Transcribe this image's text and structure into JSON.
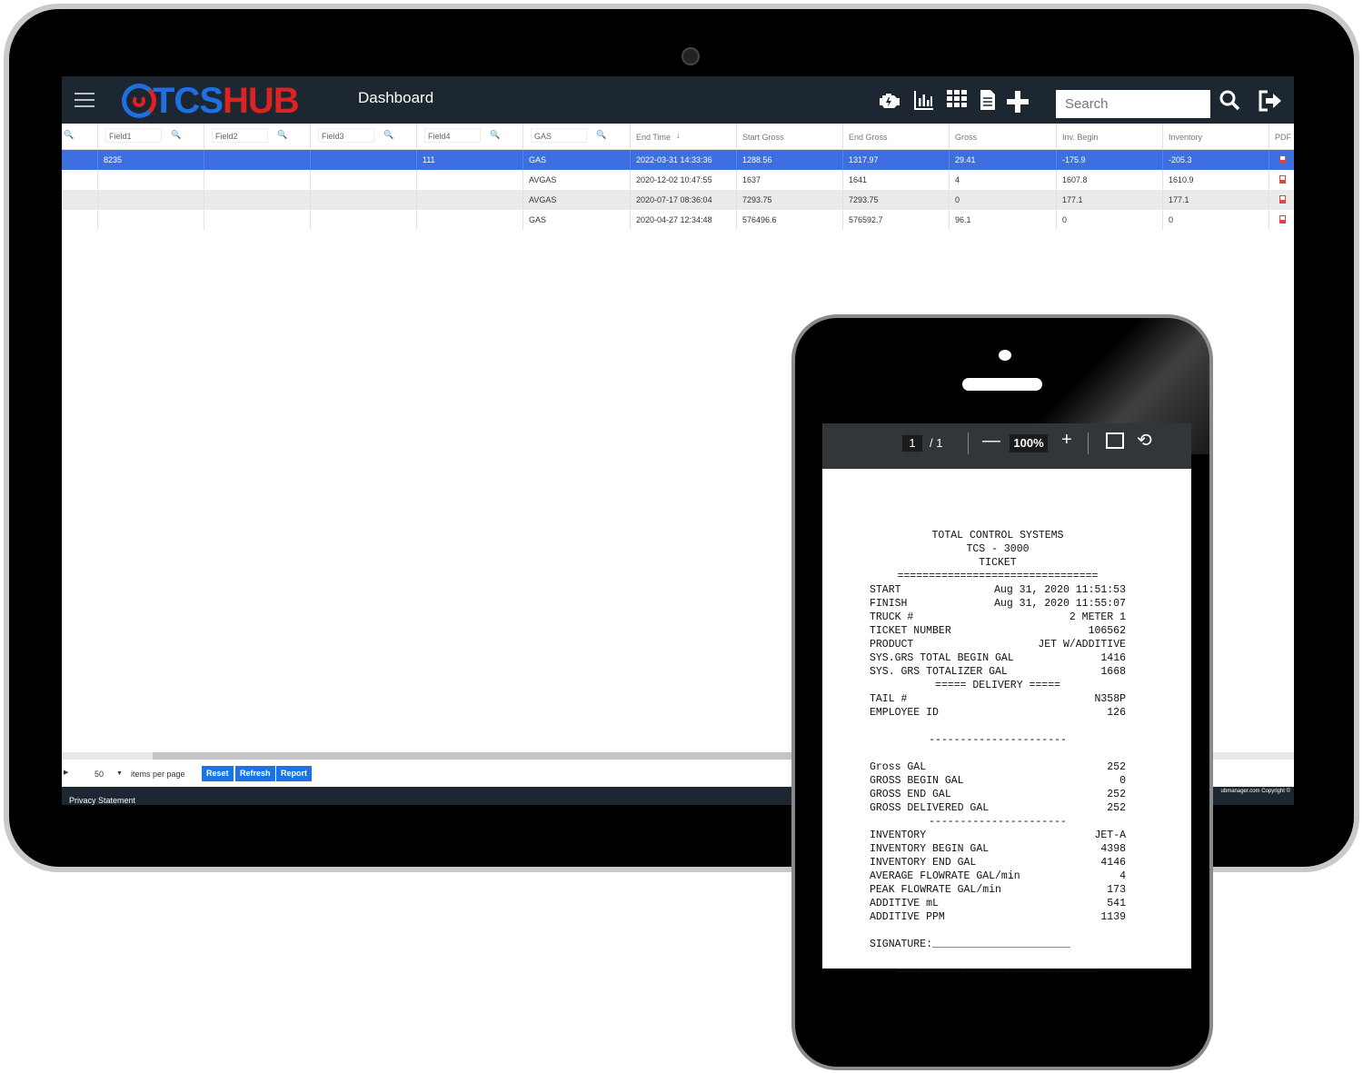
{
  "app": {
    "logo_tcs": "TCS",
    "logo_hub": "HUB",
    "page_title": "Dashboard",
    "search_placeholder": "Search",
    "toolbar_icons": [
      "engine-icon",
      "bar-chart-icon",
      "grid-icon",
      "document-icon",
      "plus-icon",
      "search-icon",
      "logout-icon"
    ]
  },
  "grid": {
    "columns": [
      {
        "key": "c0",
        "label": "",
        "filter": ""
      },
      {
        "key": "field1",
        "label": "",
        "filter": "Field1"
      },
      {
        "key": "field2",
        "label": "",
        "filter": "Field2"
      },
      {
        "key": "field3",
        "label": "",
        "filter": "Field3"
      },
      {
        "key": "field4",
        "label": "",
        "filter": "Field4"
      },
      {
        "key": "product",
        "label": "",
        "filter": "GAS"
      },
      {
        "key": "end_time",
        "label": "End Time"
      },
      {
        "key": "start_gross",
        "label": "Start Gross"
      },
      {
        "key": "end_gross",
        "label": "End Gross"
      },
      {
        "key": "gross",
        "label": "Gross"
      },
      {
        "key": "inv_begin",
        "label": "Inv. Begin"
      },
      {
        "key": "inventory",
        "label": "Inventory"
      },
      {
        "key": "pdf",
        "label": "PDF"
      }
    ],
    "rows": [
      {
        "field1": "8235",
        "field2": "",
        "field3": "",
        "field4": "111",
        "product": "GAS",
        "end_time": "2022-03-31 14:33:36",
        "start_gross": "1288.56",
        "end_gross": "1317.97",
        "gross": "29.41",
        "inv_begin": "-175.9",
        "inventory": "-205.3"
      },
      {
        "field1": "",
        "field2": "",
        "field3": "",
        "field4": "",
        "product": "AVGAS",
        "end_time": "2020-12-02 10:47:55",
        "start_gross": "1637",
        "end_gross": "1641",
        "gross": "4",
        "inv_begin": "1607.8",
        "inventory": "1610.9"
      },
      {
        "field1": "",
        "field2": "",
        "field3": "",
        "field4": "",
        "product": "AVGAS",
        "end_time": "2020-07-17 08:36:04",
        "start_gross": "7293.75",
        "end_gross": "7293.75",
        "gross": "0",
        "inv_begin": "177.1",
        "inventory": "177.1"
      },
      {
        "field1": "",
        "field2": "",
        "field3": "",
        "field4": "",
        "product": "GAS",
        "end_time": "2020-04-27 12:34:48",
        "start_gross": "576496.6",
        "end_gross": "576592.7",
        "gross": "96.1",
        "inv_begin": "0",
        "inventory": "0"
      }
    ]
  },
  "pager": {
    "page_size": "50",
    "items_per_page": "items per page",
    "reset": "Reset",
    "refresh": "Refresh",
    "report": "Report"
  },
  "footer": {
    "privacy": "Privacy Statement",
    "copyright": "ubmanager.com Copyright ©"
  },
  "pdf_viewer": {
    "page_current": "1",
    "page_total": "/ 1",
    "zoom": "100%"
  },
  "receipt": {
    "header": [
      "TOTAL CONTROL SYSTEMS",
      "TCS - 3000",
      "TICKET"
    ],
    "sep": "================================",
    "lines1": [
      [
        "START",
        "Aug 31, 2020 11:51:53"
      ],
      [
        "FINISH",
        "Aug 31, 2020 11:55:07"
      ],
      [
        "TRUCK #",
        "2 METER 1"
      ],
      [
        "TICKET NUMBER",
        "106562"
      ],
      [
        "PRODUCT",
        "JET W/ADDITIVE"
      ],
      [
        "SYS.GRS TOTAL BEGIN GAL",
        "1416"
      ],
      [
        "SYS. GRS TOTALIZER GAL",
        "1668"
      ]
    ],
    "delivery": "===== DELIVERY =====",
    "lines2": [
      [
        "TAIL #",
        "N358P"
      ],
      [
        "EMPLOYEE ID",
        "126"
      ]
    ],
    "dash": "----------------------",
    "lines3": [
      [
        "Gross GAL",
        "252"
      ],
      [
        "GROSS BEGIN GAL",
        "0"
      ],
      [
        "GROSS END GAL",
        "252"
      ],
      [
        "GROSS DELIVERED GAL",
        "252"
      ]
    ],
    "lines4": [
      [
        "INVENTORY",
        "JET-A"
      ],
      [
        "INVENTORY BEGIN GAL",
        "4398"
      ],
      [
        "INVENTORY END GAL",
        "4146"
      ],
      [
        "AVERAGE FLOWRATE GAL/min",
        "4"
      ],
      [
        "PEAK FLOWRATE GAL/min",
        "173"
      ],
      [
        "ADDITIVE mL",
        "541"
      ],
      [
        "ADDITIVE PPM",
        "1139"
      ]
    ],
    "signature": "SIGNATURE:______________________"
  }
}
